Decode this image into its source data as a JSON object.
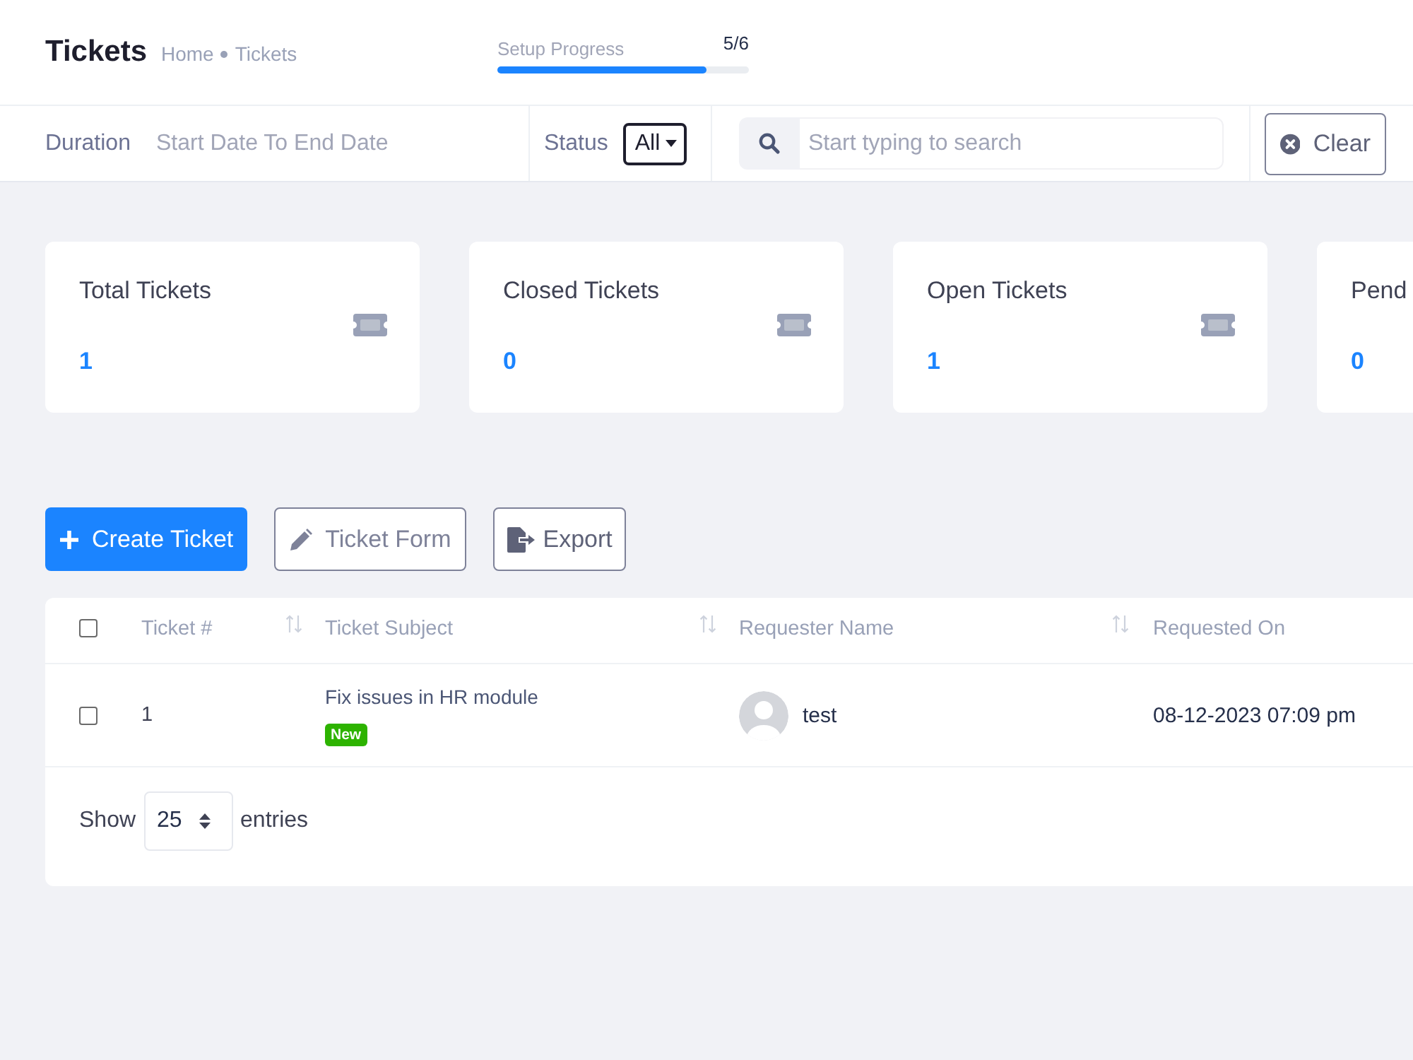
{
  "header": {
    "title": "Tickets",
    "breadcrumb": [
      {
        "label": "Home"
      },
      {
        "label": "Tickets"
      }
    ],
    "setup_progress": {
      "label": "Setup Progress",
      "reading": "5/6",
      "level": 0.83
    }
  },
  "filters": {
    "duration": {
      "label": "Duration",
      "placeholder": "Start Date To End Date"
    },
    "status": {
      "label": "Status",
      "value": "All"
    },
    "search": {
      "placeholder": "Start typing to search"
    },
    "clear_button": {
      "label": "Clear"
    }
  },
  "stat_cards": [
    {
      "title": "Total Tickets",
      "value": "1"
    },
    {
      "title": "Closed Tickets",
      "value": "0"
    },
    {
      "title": "Open Tickets",
      "value": "1"
    },
    {
      "title": "Pend",
      "value": "0"
    }
  ],
  "actions": [
    {
      "label": "Create Ticket",
      "kind": "primary"
    },
    {
      "label": "Ticket Form",
      "kind": "form"
    },
    {
      "label": "Export",
      "kind": "export"
    }
  ],
  "table": {
    "select_all": {
      "checked": false
    },
    "columns": [
      {
        "label": "Ticket #",
        "sortable": true
      },
      {
        "label": "Ticket Subject",
        "sortable": true
      },
      {
        "label": "Requester Name",
        "sortable": true
      },
      {
        "label": "Requested On",
        "sortable": false
      }
    ],
    "rows": [
      {
        "checked": false,
        "ticket_no": "1",
        "subject": "Fix issues in HR module",
        "badge": "New",
        "requester": "test",
        "requested_on": "08-12-2023 07:09 pm"
      }
    ],
    "length_menu": {
      "show_label": "Show",
      "value": "25",
      "entries_label": "entries"
    }
  }
}
